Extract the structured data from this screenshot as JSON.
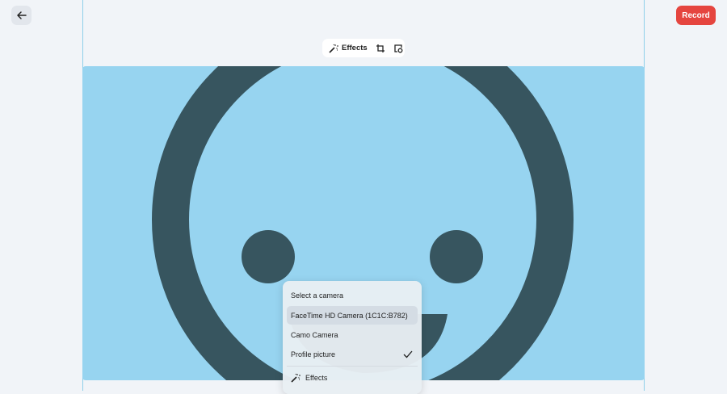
{
  "header": {
    "record_label": "Record"
  },
  "toolbar": {
    "effects_label": "Effects"
  },
  "camera_menu": {
    "title": "Select a camera",
    "items": [
      {
        "label": "FaceTime HD Camera (1C1C:B782)",
        "highlighted": true,
        "checked": false
      },
      {
        "label": "Camo Camera",
        "highlighted": false,
        "checked": false
      },
      {
        "label": "Profile picture",
        "highlighted": false,
        "checked": true
      }
    ],
    "effects_label": "Effects"
  },
  "colors": {
    "record": "#e5453f",
    "preview_bg": "#97d4f0",
    "face": "#37555f"
  }
}
